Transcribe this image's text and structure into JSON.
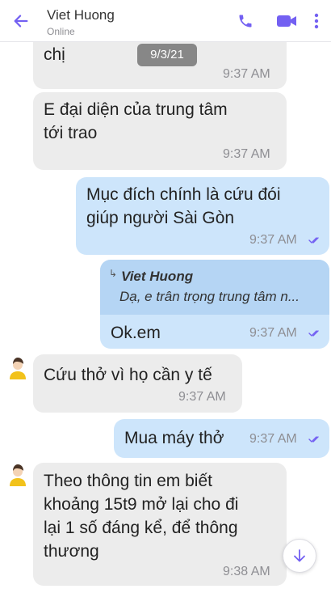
{
  "header": {
    "contact_name": "Viet Huong",
    "status": "Online",
    "icons": [
      "back-arrow-icon",
      "phone-icon",
      "video-camera-icon",
      "more-vertical-icon"
    ],
    "accent_color": "#7360f2"
  },
  "date_pill": "9/3/21",
  "messages": [
    {
      "dir": "in",
      "text": "chị",
      "time": "9:37 AM"
    },
    {
      "dir": "in",
      "lines": [
        "E đại diện của trung tâm",
        "tới trao"
      ],
      "time": "9:37 AM"
    },
    {
      "dir": "out",
      "lines": [
        "Mục đích chính là cứu đói",
        "giúp người Sài Gòn"
      ],
      "time": "9:37 AM"
    },
    {
      "dir": "out",
      "quote": {
        "name": "Viet Huong",
        "text": "Dạ, e trân trọng trung tâm n..."
      },
      "text": "Ok.em",
      "time": "9:37 AM"
    },
    {
      "dir": "in",
      "text": "Cứu thở vì họ cần y tế",
      "time": "9:37 AM"
    },
    {
      "dir": "out",
      "text": "Mua máy thở",
      "time": "9:37 AM"
    },
    {
      "dir": "in",
      "lines": [
        "Theo thông tin em biết",
        "khoảng 15t9 mở lại cho đi",
        "lại 1 số đáng kể, để thông",
        "thương"
      ],
      "time": "9:38 AM"
    }
  ],
  "colors": {
    "incoming_bubble": "#ececec",
    "outgoing_bubble": "#cde5fb",
    "quote_background": "#b5d5f4",
    "read_tick": "#7360f2"
  }
}
